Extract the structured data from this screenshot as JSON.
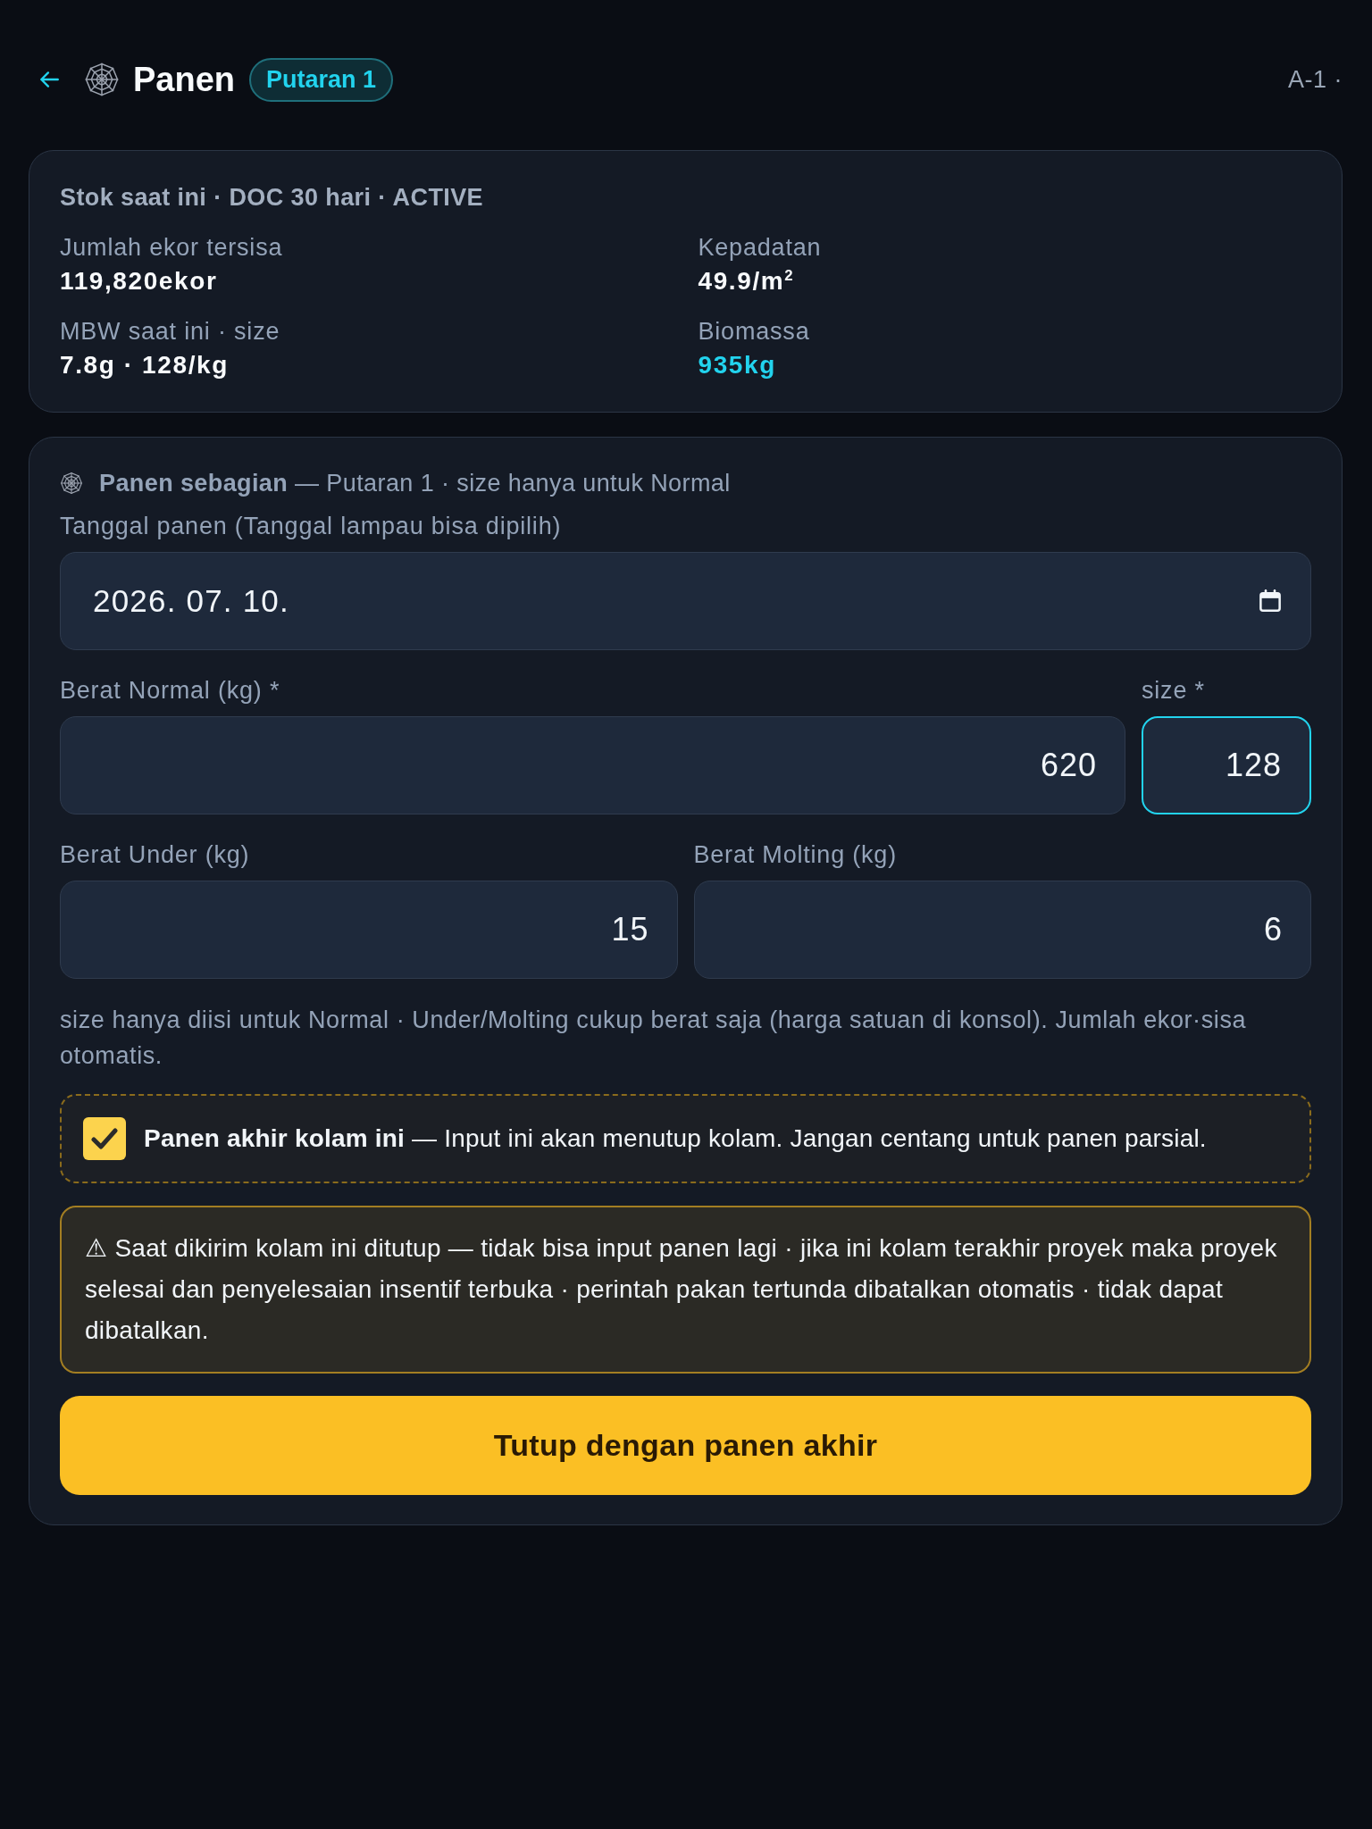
{
  "header": {
    "title": "Panen",
    "badge": "Putaran 1",
    "pond": "A-1 ·"
  },
  "stock": {
    "title": "Stok saat ini · DOC 30 hari · ACTIVE",
    "stats": [
      {
        "label": "Jumlah ekor tersisa",
        "value": "119,820ekor",
        "highlight": false
      },
      {
        "label": "Kepadatan",
        "value": "49.9/m$^{2}$",
        "highlight": false
      },
      {
        "label": "MBW saat ini · size",
        "value": "7.8g · 128/kg",
        "highlight": false
      },
      {
        "label": "Biomassa",
        "value": "935kg",
        "highlight": true
      }
    ]
  },
  "form": {
    "heading": "**Panen sebagian** — Putaran 1 · size hanya untuk Normal",
    "date": {
      "label": "Tanggal panen (Tanggal lampau bisa dipilih)",
      "value": "2026. 07. 10."
    },
    "fields": [
      {
        "label": "Berat Normal (kg) *",
        "value": "620",
        "focused": false
      },
      {
        "label": "size *",
        "value": "128",
        "focused": true
      },
      {
        "label": "Berat Under (kg)",
        "value": "15",
        "focused": false
      },
      {
        "label": "Berat Molting (kg)",
        "value": "6",
        "focused": false
      }
    ],
    "help": "size hanya diisi untuk Normal · Under/Molting cukup berat saja (harga satuan di konsol). Jumlah ekor·sisa otomatis.",
    "final": {
      "checked": true,
      "text": "**Panen akhir kolam ini** — Input ini akan menutup kolam. Jangan centang untuk panen parsial."
    },
    "warning": "⚠ Saat dikirim kolam ini ditutup — tidak bisa input panen lagi · jika ini kolam terakhir proyek maka proyek selesai dan penyelesaian insentif terbuka · perintah pakan tertunda dibatalkan otomatis · tidak dapat dibatalkan.",
    "submit": "Tutup dengan panen akhir"
  }
}
